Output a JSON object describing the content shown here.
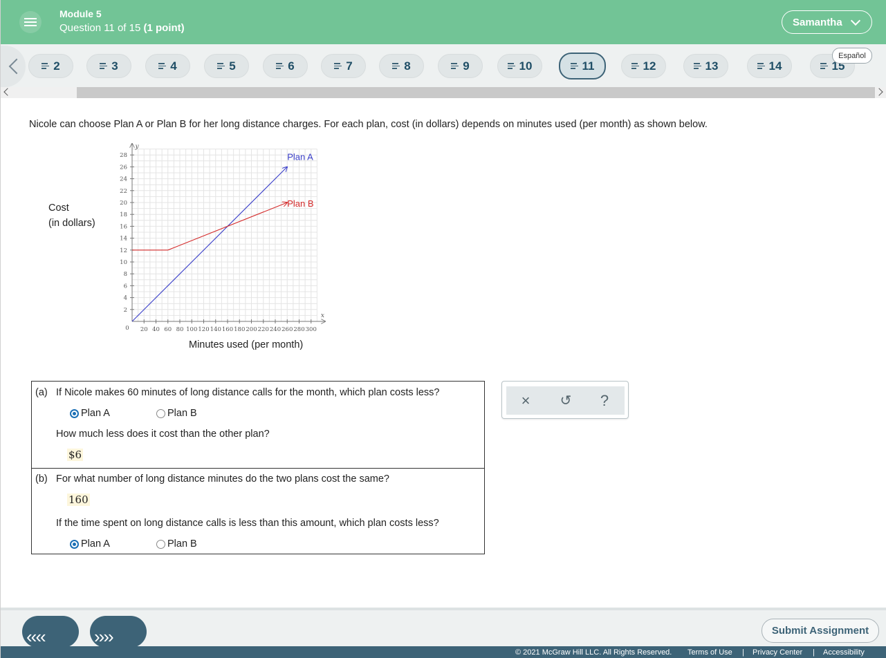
{
  "header": {
    "module": "Module 5",
    "question_prefix": "Question 11 of 15",
    "points": "(1 point)",
    "user": "Samantha",
    "language_toggle": "Español"
  },
  "question_nav": {
    "items": [
      "2",
      "3",
      "4",
      "5",
      "6",
      "7",
      "8",
      "9",
      "10",
      "11",
      "12",
      "13",
      "14",
      "15"
    ],
    "active": "11"
  },
  "problem": {
    "text": "Nicole can choose Plan A or Plan B for her long distance charges. For each plan, cost (in dollars) depends on minutes used (per month) as shown below.",
    "ylabel_line1": "Cost",
    "ylabel_line2": "(in dollars)",
    "xlabel": "Minutes used (per month)"
  },
  "chart_data": {
    "type": "line",
    "x_axis_var": "x",
    "y_axis_var": "y",
    "xlim": [
      0,
      310
    ],
    "ylim": [
      0,
      29
    ],
    "x_ticks": [
      20,
      40,
      60,
      80,
      100,
      120,
      140,
      160,
      180,
      200,
      220,
      240,
      260,
      280,
      300
    ],
    "y_ticks": [
      2,
      4,
      6,
      8,
      10,
      12,
      14,
      16,
      18,
      20,
      22,
      24,
      26,
      28
    ],
    "origin_label": "0",
    "grid": true,
    "series": [
      {
        "name": "Plan A",
        "color": "#3a3fc9",
        "points": [
          [
            0,
            0
          ],
          [
            260,
            26
          ]
        ]
      },
      {
        "name": "Plan B",
        "color": "#d42a2a",
        "points": [
          [
            0,
            12
          ],
          [
            60,
            12
          ],
          [
            260,
            20
          ]
        ]
      }
    ]
  },
  "part_a": {
    "label": "(a)",
    "question": "If Nicole makes 60 minutes of long distance calls for the month, which plan costs less?",
    "options": [
      "Plan A",
      "Plan B"
    ],
    "selected": "Plan A",
    "followup": "How much less does it cost than the other plan?",
    "answer": "$6"
  },
  "part_b": {
    "label": "(b)",
    "question": "For what number of long distance minutes do the two plans cost the same?",
    "answer": "160",
    "followup": "If the time spent on long distance calls is less than this amount, which plan costs less?",
    "options": [
      "Plan A",
      "Plan B"
    ],
    "selected": "Plan A"
  },
  "tools": {
    "clear": "×",
    "undo": "↺",
    "help": "?"
  },
  "footer": {
    "back_label": "‹‹‹‹",
    "next_label": "››››",
    "submit": "Submit Assignment",
    "copyright": "© 2021 McGraw Hill LLC. All Rights Reserved.",
    "terms": "Terms of Use",
    "privacy": "Privacy Center",
    "accessibility": "Accessibility",
    "separator": "|"
  }
}
